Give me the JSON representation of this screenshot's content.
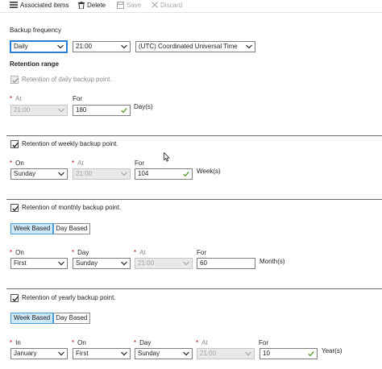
{
  "toolbar": {
    "associated_items": "Associated items",
    "delete": "Delete",
    "save": "Save",
    "discard": "Discard"
  },
  "backup_frequency": {
    "label": "Backup frequency",
    "frequency": "Daily",
    "time": "21:00",
    "timezone": "(UTC) Coordinated Universal Time"
  },
  "retention_range": {
    "label": "Retention range"
  },
  "daily": {
    "checkbox_label": "Retention of daily backup point.",
    "at_label": "At",
    "at_value": "21:00",
    "for_label": "For",
    "for_value": "180",
    "unit": "Day(s)"
  },
  "weekly": {
    "checkbox_label": "Retention of weekly backup point.",
    "on_label": "On",
    "on_value": "Sunday",
    "at_label": "At",
    "at_value": "21:00",
    "for_label": "For",
    "for_value": "104",
    "unit": "Week(s)"
  },
  "monthly": {
    "checkbox_label": "Retention of monthly backup point.",
    "week_based": "Week Based",
    "day_based": "Day Based",
    "on_label": "On",
    "on_value": "First",
    "day_label": "Day",
    "day_value": "Sunday",
    "at_label": "At",
    "at_value": "21:00",
    "for_label": "For",
    "for_value": "60",
    "unit": "Month(s)"
  },
  "yearly": {
    "checkbox_label": "Retention of yearly backup point.",
    "week_based": "Week Based",
    "day_based": "Day Based",
    "in_label": "In",
    "in_value": "January",
    "on_label": "On",
    "on_value": "First",
    "day_label": "Day",
    "day_value": "Sunday",
    "at_label": "At",
    "at_value": "21:00",
    "for_label": "For",
    "for_value": "10",
    "unit": "Year(s)"
  },
  "icons": {
    "associated_items": "list-icon",
    "delete": "trash-icon",
    "save": "save-icon",
    "discard": "close-icon",
    "dropdown": "chevron-down-icon",
    "valid": "checkmark-icon",
    "cursor": "mouse-pointer-icon"
  },
  "colors": {
    "focus_blue": "#2a7fd4",
    "valid_green": "#5aa02c",
    "selected_segment": "#cde8f6",
    "required_red": "#c00000"
  }
}
